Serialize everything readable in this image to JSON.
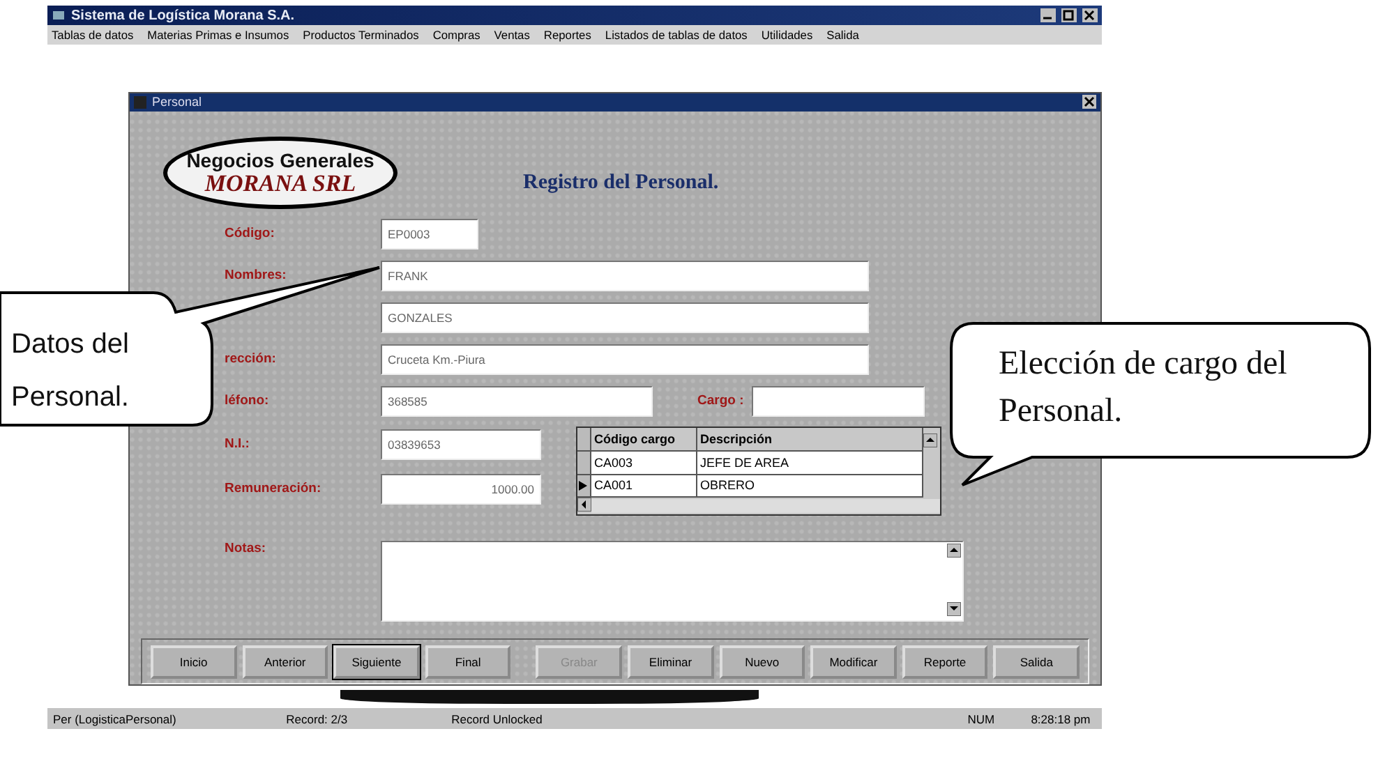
{
  "app": {
    "title": "Sistema de Logística Morana S.A."
  },
  "menu": [
    "Tablas de datos",
    "Materias Primas e Insumos",
    "Productos Terminados",
    "Compras",
    "Ventas",
    "Reportes",
    "Listados de tablas de datos",
    "Utilidades",
    "Salida"
  ],
  "window": {
    "title": "Personal"
  },
  "logo": {
    "line1": "Negocios Generales",
    "line2": "MORANA SRL"
  },
  "heading": "Registro del Personal.",
  "fields": [
    {
      "label": "Código:",
      "value": "EP0003"
    },
    {
      "label": "Nombres:",
      "value": "FRANK"
    },
    {
      "value": "GONZALES"
    },
    {
      "label": "rección:",
      "value": "Cruceta Km.-Piura"
    },
    {
      "label": "léfono:",
      "value": "368585"
    },
    {
      "label": "N.I.:",
      "value": "03839653"
    },
    {
      "label": "Remuneración:",
      "value": "1000.00"
    },
    {
      "label": "Notas:"
    }
  ],
  "cargo": {
    "label": "Cargo :",
    "columns": [
      "Código cargo",
      "Descripción"
    ],
    "rows": [
      {
        "cells": [
          "CA003",
          "JEFE DE AREA"
        ],
        "selected": false
      },
      {
        "cells": [
          "CA001",
          "OBRERO"
        ],
        "selected": true
      }
    ]
  },
  "buttons": [
    {
      "label": "Inicio",
      "default": false,
      "disabled": false
    },
    {
      "label": "Anterior",
      "default": false,
      "disabled": false
    },
    {
      "label": "Siguiente",
      "default": true,
      "disabled": false
    },
    {
      "label": "Final",
      "default": false,
      "disabled": false
    },
    {
      "label": "Grabar",
      "default": false,
      "disabled": true
    },
    {
      "label": "Eliminar",
      "default": false,
      "disabled": false
    },
    {
      "label": "Nuevo",
      "default": false,
      "disabled": false
    },
    {
      "label": "Modificar",
      "default": false,
      "disabled": false
    },
    {
      "label": "Reporte",
      "default": false,
      "disabled": false
    },
    {
      "label": "Salida",
      "default": false,
      "disabled": false
    }
  ],
  "status_bar": [
    "Per (LogisticaPersonal)",
    "Record: 2/3",
    "Record Unlocked",
    "NUM",
    "8:28:18 pm"
  ],
  "callouts": [
    {
      "text": "Datos del Personal."
    },
    {
      "text": "Elección de cargo del Personal."
    }
  ]
}
